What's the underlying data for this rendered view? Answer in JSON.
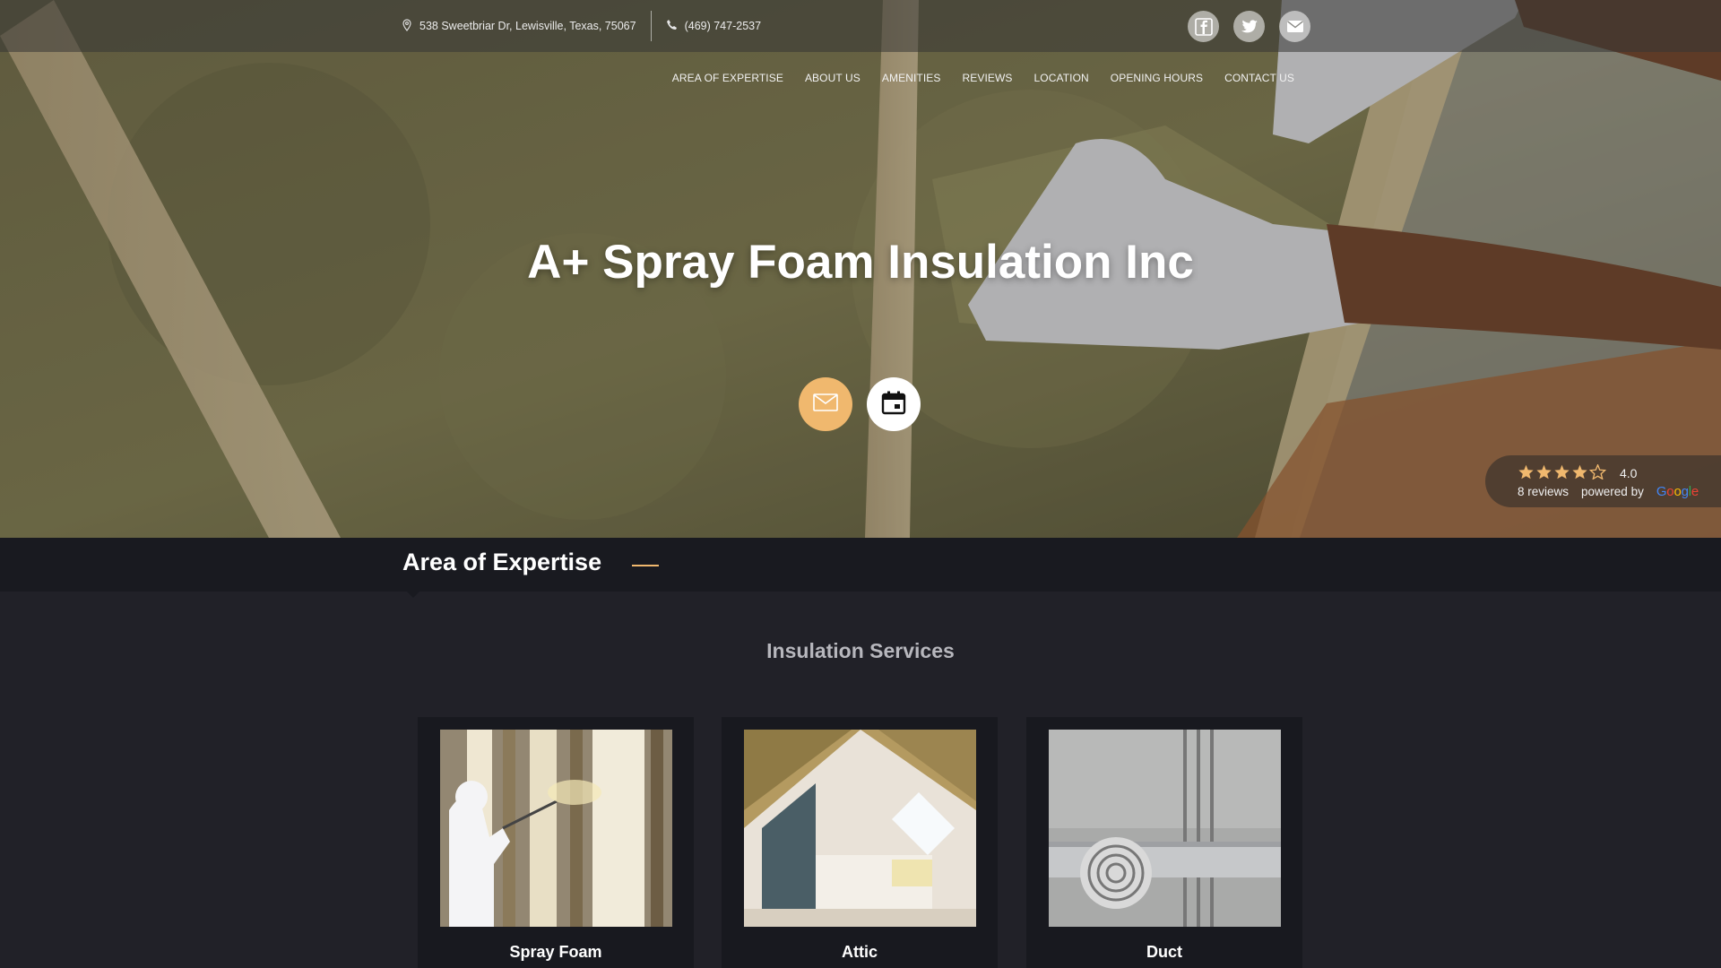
{
  "topbar": {
    "address": "538 Sweetbriar Dr, Lewisville, Texas, 75067",
    "phone": "(469) 747-2537",
    "socials": [
      {
        "icon": "facebook-icon"
      },
      {
        "icon": "twitter-icon"
      },
      {
        "icon": "mail-icon"
      }
    ]
  },
  "nav": {
    "items": [
      "AREA OF EXPERTISE",
      "ABOUT US",
      "AMENITIES",
      "REVIEWS",
      "LOCATION",
      "OPENING HOURS",
      "CONTACT US"
    ]
  },
  "hero": {
    "title": "A+ Spray Foam Insulation Inc",
    "cta_icons": [
      "mail-icon",
      "calendar-icon"
    ]
  },
  "rating": {
    "stars": 4,
    "max_stars": 5,
    "score": "4.0",
    "reviews": "8 reviews",
    "powered_by": "powered by",
    "provider": "Google"
  },
  "expertise": {
    "title": "Area of Expertise",
    "subtitle": "Insulation Services",
    "cards": [
      {
        "label": "Spray Foam"
      },
      {
        "label": "Attic"
      },
      {
        "label": "Duct"
      }
    ]
  },
  "colors": {
    "accent": "#f0b86e",
    "page_bg": "#212128",
    "section_bar": "#191a20",
    "card_bg": "#18191f"
  }
}
